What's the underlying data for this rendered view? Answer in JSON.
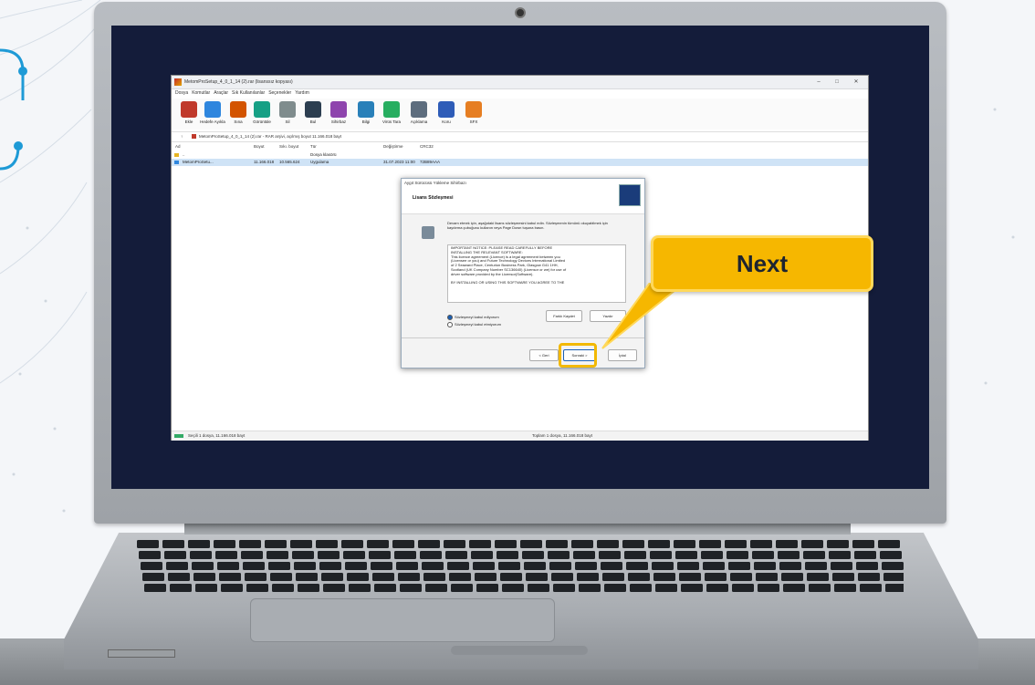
{
  "window": {
    "title": "MetomProSetup_4_0_1_14 (2).rar (lisanssız kopyası)",
    "menu": [
      "Dosya",
      "Komutlar",
      "Araçlar",
      "Sık Kullanılanlar",
      "Seçenekler",
      "Yardım"
    ],
    "toolbar": [
      {
        "label": "Ekle",
        "icon": "add-archive-icon",
        "color": "#c0392b"
      },
      {
        "label": "Hedefe Ayıkla",
        "icon": "extract-icon",
        "color": "#2e86de"
      },
      {
        "label": "Sına",
        "icon": "test-icon",
        "color": "#d35400"
      },
      {
        "label": "Görüntüle",
        "icon": "view-icon",
        "color": "#16a085"
      },
      {
        "label": "Sil",
        "icon": "delete-icon",
        "color": "#7f8c8d"
      },
      {
        "label": "Bul",
        "icon": "find-icon",
        "color": "#2c3e50"
      },
      {
        "label": "Sihirbaz",
        "icon": "wizard-icon",
        "color": "#8e44ad"
      },
      {
        "label": "Bilgi",
        "icon": "info-icon",
        "color": "#2980b9"
      },
      {
        "label": "Virüs Tara",
        "icon": "virus-scan-icon",
        "color": "#27ae60"
      },
      {
        "label": "Açıklama",
        "icon": "comment-icon",
        "color": "#5d6d7e"
      },
      {
        "label": "Koru",
        "icon": "protect-icon",
        "color": "#2e5cb8"
      },
      {
        "label": "SFX",
        "icon": "sfx-icon",
        "color": "#e67e22"
      }
    ],
    "address": "MetomProSetup_4_0_1_14 (2).rar - RAR arşivi, açılmış boyut 11.166.018 bayt",
    "columns": [
      "Ad",
      "Boyut",
      "Sıkı. boyut",
      "Tür",
      "Değiştirme",
      "CRC32"
    ],
    "rows": [
      {
        "name": "..",
        "size": "",
        "packed": "",
        "type": "Dosya klasörü",
        "modified": "",
        "crc": ""
      },
      {
        "name": "MetomProSetu...",
        "size": "11.166.018",
        "packed": "10.565.624",
        "type": "Uygulama",
        "modified": "31.07.2023 11:00",
        "crc": "72B89AAA"
      }
    ],
    "status_left": "Seçili 1 dosya, 11.166.018 bayt",
    "status_right": "Toplam 1 dosya, 11.166.018 bayt"
  },
  "dialog": {
    "title": "Aygıt Sürücüsü Yükleme Sihirbazı",
    "heading": "Lisans Sözleşmesi",
    "intro": "Devam etmek için, aşağıdaki lisans sözleşmesini kabul edin. Sözleşmenin tümünü okuyabilmek için kaydırma çubuğunu kullanın veya Page Down tuşuna basın.",
    "license_lines": [
      "IMPORTANT NOTICE: PLEASE READ CAREFULLY BEFORE",
      "INSTALLING THE RELEVANT SOFTWARE:",
      "This licence agreement (Licence) is a legal agreement between you",
      "(Licensee or you) and Future Technology Devices International Limited",
      "of 2 Seaward Place, Centurion Business Park, Glasgow G41 1HH,",
      "Scotland (UK Company Number SC136640) (Licensor or we) for use of",
      "driver software provided by the Licensor(Software).",
      "",
      "BY INSTALLING OR USING THIS SOFTWARE YOU AGREE TO THE"
    ],
    "accept_label": "Sözleşmeyi kabul ediyorum",
    "decline_label": "Sözleşmeyi kabul etmiyorum",
    "save_as": "Farklı Kaydet",
    "print": "Yazdır",
    "back": "< Geri",
    "next": "Sonraki >",
    "cancel": "İptal"
  },
  "callout": {
    "text": "Next",
    "color": "#f6b700"
  }
}
